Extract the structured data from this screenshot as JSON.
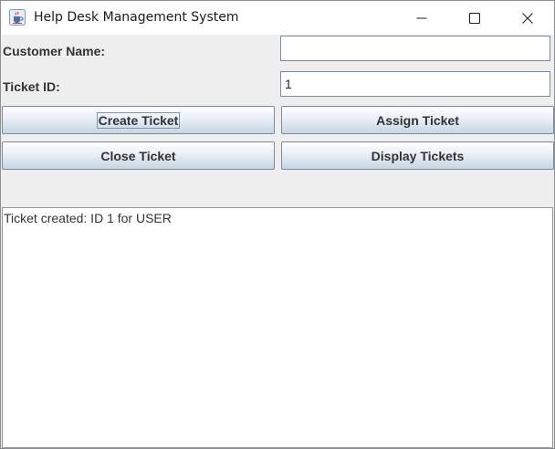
{
  "window": {
    "title": "Help Desk Management System"
  },
  "form": {
    "customer_name_label": "Customer Name:",
    "customer_name_value": "",
    "ticket_id_label": "Ticket ID:",
    "ticket_id_value": "1"
  },
  "buttons": {
    "create": "Create Ticket",
    "assign": "Assign Ticket",
    "close": "Close Ticket",
    "display": "Display Tickets"
  },
  "output": {
    "text": "Ticket created: ID 1 for USER"
  },
  "icons": {
    "app": "java-cup-icon",
    "minimize": "minimize-icon",
    "maximize": "maximize-icon",
    "close": "close-icon"
  }
}
